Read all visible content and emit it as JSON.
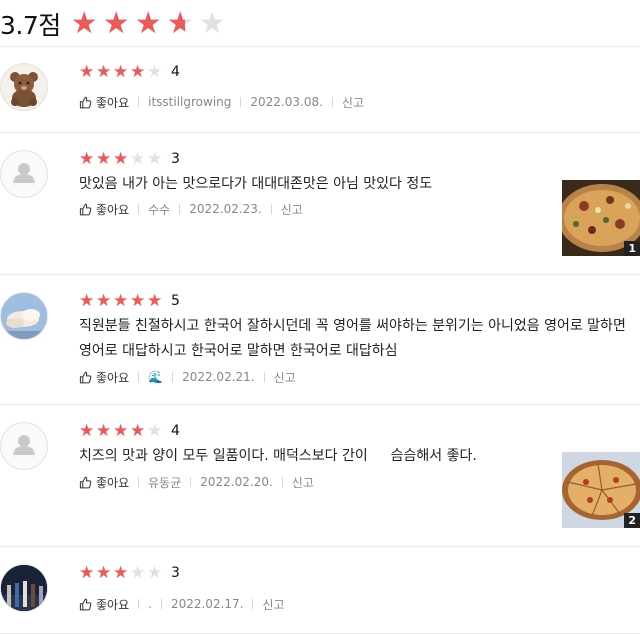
{
  "summary": {
    "average": "3.7점",
    "rating": 3.7
  },
  "ui": {
    "like_label": "좋아요",
    "report_label": "신고"
  },
  "reviews": [
    {
      "rating": 4,
      "score": "4",
      "text": "",
      "user": "itsstillgrowing",
      "date": "2022.03.08.",
      "avatar": "teddy-bear-avatar",
      "photo_count": ""
    },
    {
      "rating": 3,
      "score": "3",
      "text": "맛있음 내가 아는 맛으로다가 대대대존맛은 아님 맛있다 정도",
      "user": "수수",
      "date": "2022.02.23.",
      "avatar": "default-avatar",
      "photo_count": "1"
    },
    {
      "rating": 5,
      "score": "5",
      "text": "직원분들 친절하시고 한국어 잘하시던데 꼭 영어를 써야하는 분위기는 아니었음 영어로 말하면 영어로 대답하시고 한국어로 말하면 한국어로 대답하심",
      "user": "🌊",
      "date": "2022.02.21.",
      "avatar": "sky-avatar",
      "photo_count": ""
    },
    {
      "rating": 4,
      "score": "4",
      "text": "치즈의 맛과 양이 모두 일품이다. 매덕스보다 간이 　 슴슴해서 좋다.",
      "user": "유동균",
      "date": "2022.02.20.",
      "avatar": "default-avatar",
      "photo_count": "2"
    },
    {
      "rating": 3,
      "score": "3",
      "text": "",
      "user": ".",
      "date": "2022.02.17.",
      "avatar": "night-scene-avatar",
      "photo_count": ""
    }
  ]
}
